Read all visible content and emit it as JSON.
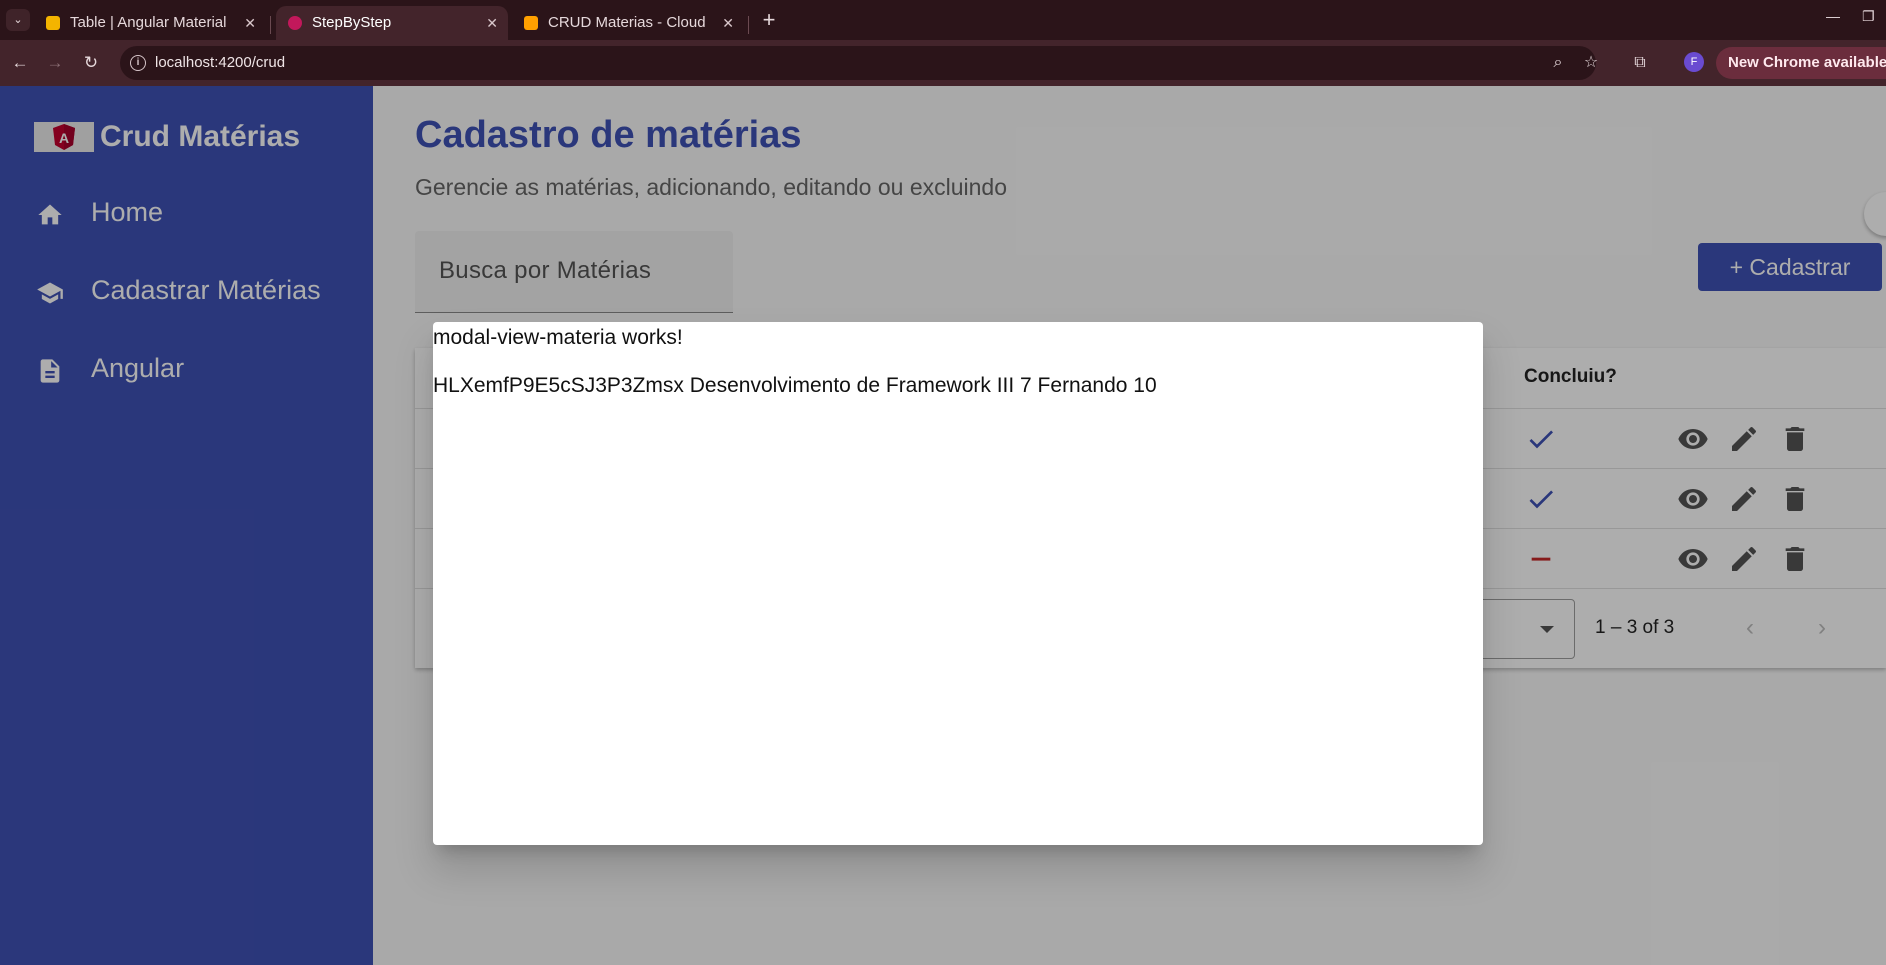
{
  "browser": {
    "tabs": [
      {
        "title": "Table | Angular Material",
        "active": false
      },
      {
        "title": "StepByStep",
        "active": true
      },
      {
        "title": "CRUD Materias - Cloud F",
        "active": false
      }
    ],
    "url": "localhost:4200/crud",
    "profile_initial": "F",
    "update_label": "New Chrome available"
  },
  "sidebar": {
    "brand": "Crud Matérias",
    "items": [
      {
        "label": "Home",
        "icon": "home-icon"
      },
      {
        "label": "Cadastrar Matérias",
        "icon": "school-icon"
      },
      {
        "label": "Angular",
        "icon": "document-icon"
      }
    ]
  },
  "main": {
    "title": "Cadastro de matérias",
    "subtitle": "Gerencie as matérias, adicionando, editando ou excluindo",
    "search_label": "Busca por Matérias",
    "add_button": "+ Cadastrar",
    "table": {
      "visible_header": "Concluiu?",
      "rows": [
        {
          "concluiu": true
        },
        {
          "concluiu": true
        },
        {
          "concluiu": false
        }
      ]
    },
    "paginator": {
      "range": "1 – 3 of 3"
    }
  },
  "modal": {
    "heading": "modal-view-materia works!",
    "detail": "HLXemfP9E5cSJ3P3Zmsx Desenvolvimento de Framework III 7 Fernando 10"
  },
  "colors": {
    "primary": "#3f51b5",
    "check": "#3f51b5",
    "dash": "#c62828",
    "chrome_tabstrip": "#2b1419",
    "chrome_toolbar": "#43242b"
  }
}
